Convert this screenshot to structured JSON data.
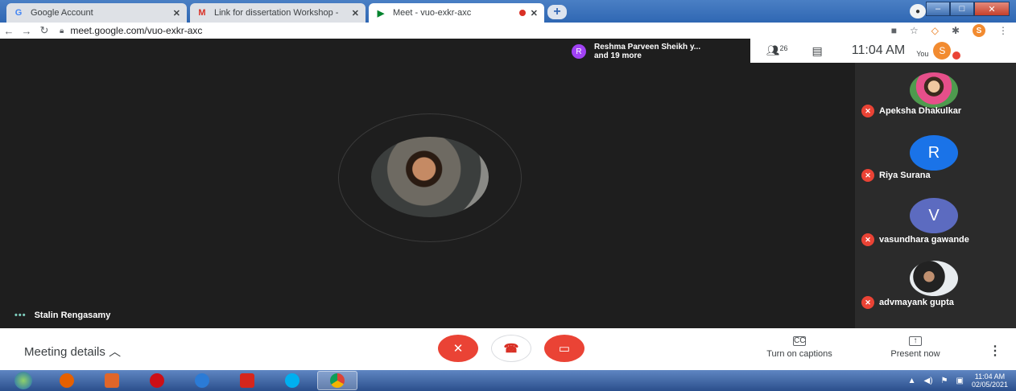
{
  "browser": {
    "tabs": [
      {
        "label": "Google Account",
        "icon": "G"
      },
      {
        "label": "Link for dissertation Workshop -",
        "icon": "M"
      },
      {
        "label": "Meet - vuo-exkr-axc",
        "icon": "▶"
      }
    ],
    "new_tab": "+",
    "url": "meet.google.com/vuo-exkr-axc",
    "profile_initial": "S"
  },
  "meet": {
    "participants_pill": {
      "avatar_initial": "R",
      "line1": "Reshma Parveen Sheikh y...",
      "line2": "and 19 more"
    },
    "people_count": "26",
    "time": "11:04 AM",
    "you_label": "You",
    "you_initial": "S",
    "main_speaker": "Stalin Rengasamy",
    "sidebar": [
      {
        "name": "Apeksha Dhakulkar",
        "avatar": "",
        "kind": "photo"
      },
      {
        "name": "Riya Surana",
        "avatar": "R",
        "kind": "letter",
        "color": "#1a73e8"
      },
      {
        "name": "vasundhara gawande",
        "avatar": "V",
        "kind": "letter",
        "color": "#5c6bc0"
      },
      {
        "name": "advmayank gupta",
        "avatar": "",
        "kind": "photo"
      }
    ],
    "controls": {
      "meeting_details": "Meeting details",
      "captions": "Turn on captions",
      "present": "Present now",
      "captions_glyph": "CC",
      "present_glyph": "↑"
    }
  },
  "taskbar": {
    "time": "11:04 AM",
    "date": "02/05/2021"
  }
}
